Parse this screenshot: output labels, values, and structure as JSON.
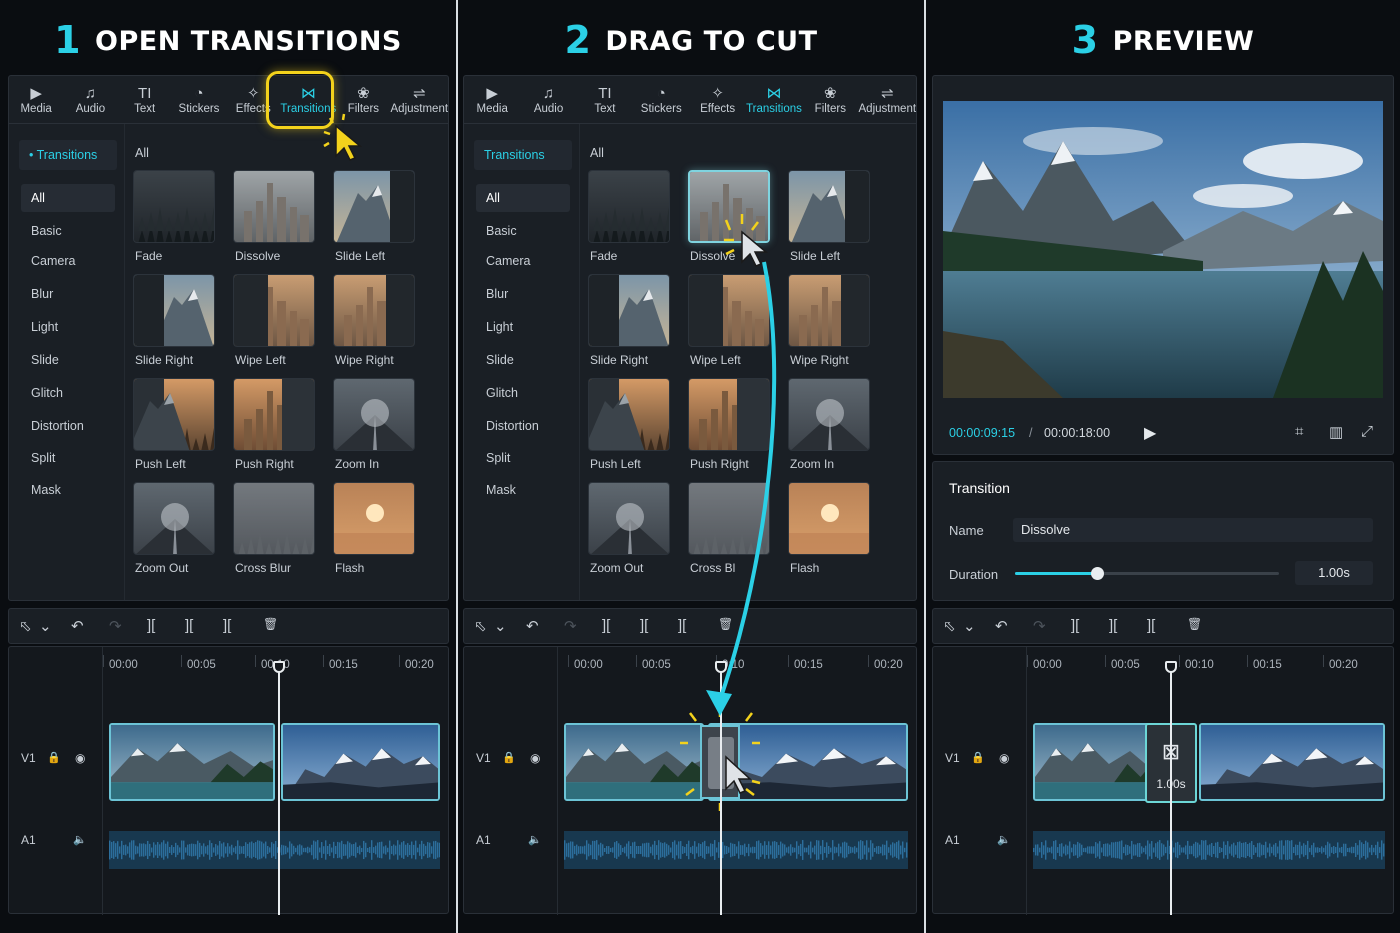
{
  "steps": [
    {
      "num": "1",
      "title": "OPEN TRANSITIONS"
    },
    {
      "num": "2",
      "title": "DRAG TO CUT"
    },
    {
      "num": "3",
      "title": "PREVIEW"
    }
  ],
  "toolbar": [
    {
      "label": "Media",
      "icon": "media-icon",
      "glyph": "▶"
    },
    {
      "label": "Audio",
      "icon": "audio-icon",
      "glyph": "♫"
    },
    {
      "label": "Text",
      "icon": "text-icon",
      "glyph": "TI"
    },
    {
      "label": "Stickers",
      "icon": "stickers-icon",
      "glyph": "◔"
    },
    {
      "label": "Effects",
      "icon": "effects-icon",
      "glyph": "✧"
    },
    {
      "label": "Transitions",
      "icon": "transitions-icon",
      "glyph": "⋈"
    },
    {
      "label": "Filters",
      "icon": "filters-icon",
      "glyph": "❀"
    },
    {
      "label": "Adjustment",
      "icon": "adjustment-icon",
      "glyph": "⇌"
    }
  ],
  "sidebar": {
    "panel1_header": "• Transitions",
    "panel2_header": "Transitions",
    "items": [
      "All",
      "Basic",
      "Camera",
      "Blur",
      "Light",
      "Slide",
      "Glitch",
      "Distortion",
      "Split",
      "Mask"
    ]
  },
  "grid": {
    "header": "All",
    "items": [
      {
        "label": "Fade",
        "style": "forest"
      },
      {
        "label": "Dissolve",
        "style": "city"
      },
      {
        "label": "Slide Left",
        "style": "mtn-dark"
      },
      {
        "label": "Slide Right",
        "style": "dark-mtn"
      },
      {
        "label": "Wipe Left",
        "style": "dark-city"
      },
      {
        "label": "Wipe Right",
        "style": "city-dark"
      },
      {
        "label": "Push Left",
        "style": "dark-trees"
      },
      {
        "label": "Push Right",
        "style": "city-dark2"
      },
      {
        "label": "Zoom In",
        "style": "road"
      },
      {
        "label": "Zoom Out",
        "style": "road"
      },
      {
        "label": "Cross Blur",
        "style": "blur"
      },
      {
        "label": "Flash",
        "style": "sunset"
      }
    ],
    "panel2_dissolve_label": "Dissolve",
    "panel2_crossblur_label": "Cross Bl"
  },
  "timeline": {
    "ruler": [
      "00:00",
      "00:05",
      "00:10",
      "00:15",
      "00:20"
    ],
    "panel2_ruler_mid": "0:10",
    "video_track": "V1",
    "audio_track": "A1",
    "transition_duration": "1.00s"
  },
  "preview": {
    "current_time": "00:00:09:15",
    "separator": "/",
    "total_time": "00:00:18:00",
    "accent": "#2bd0e6"
  },
  "properties": {
    "title": "Transition",
    "name_label": "Name",
    "name_value": "Dissolve",
    "duration_label": "Duration",
    "duration_value": "1.00s",
    "duration_fraction": 0.31
  },
  "colors": {
    "accent": "#2bd0e6",
    "highlight": "#f3d21c"
  }
}
